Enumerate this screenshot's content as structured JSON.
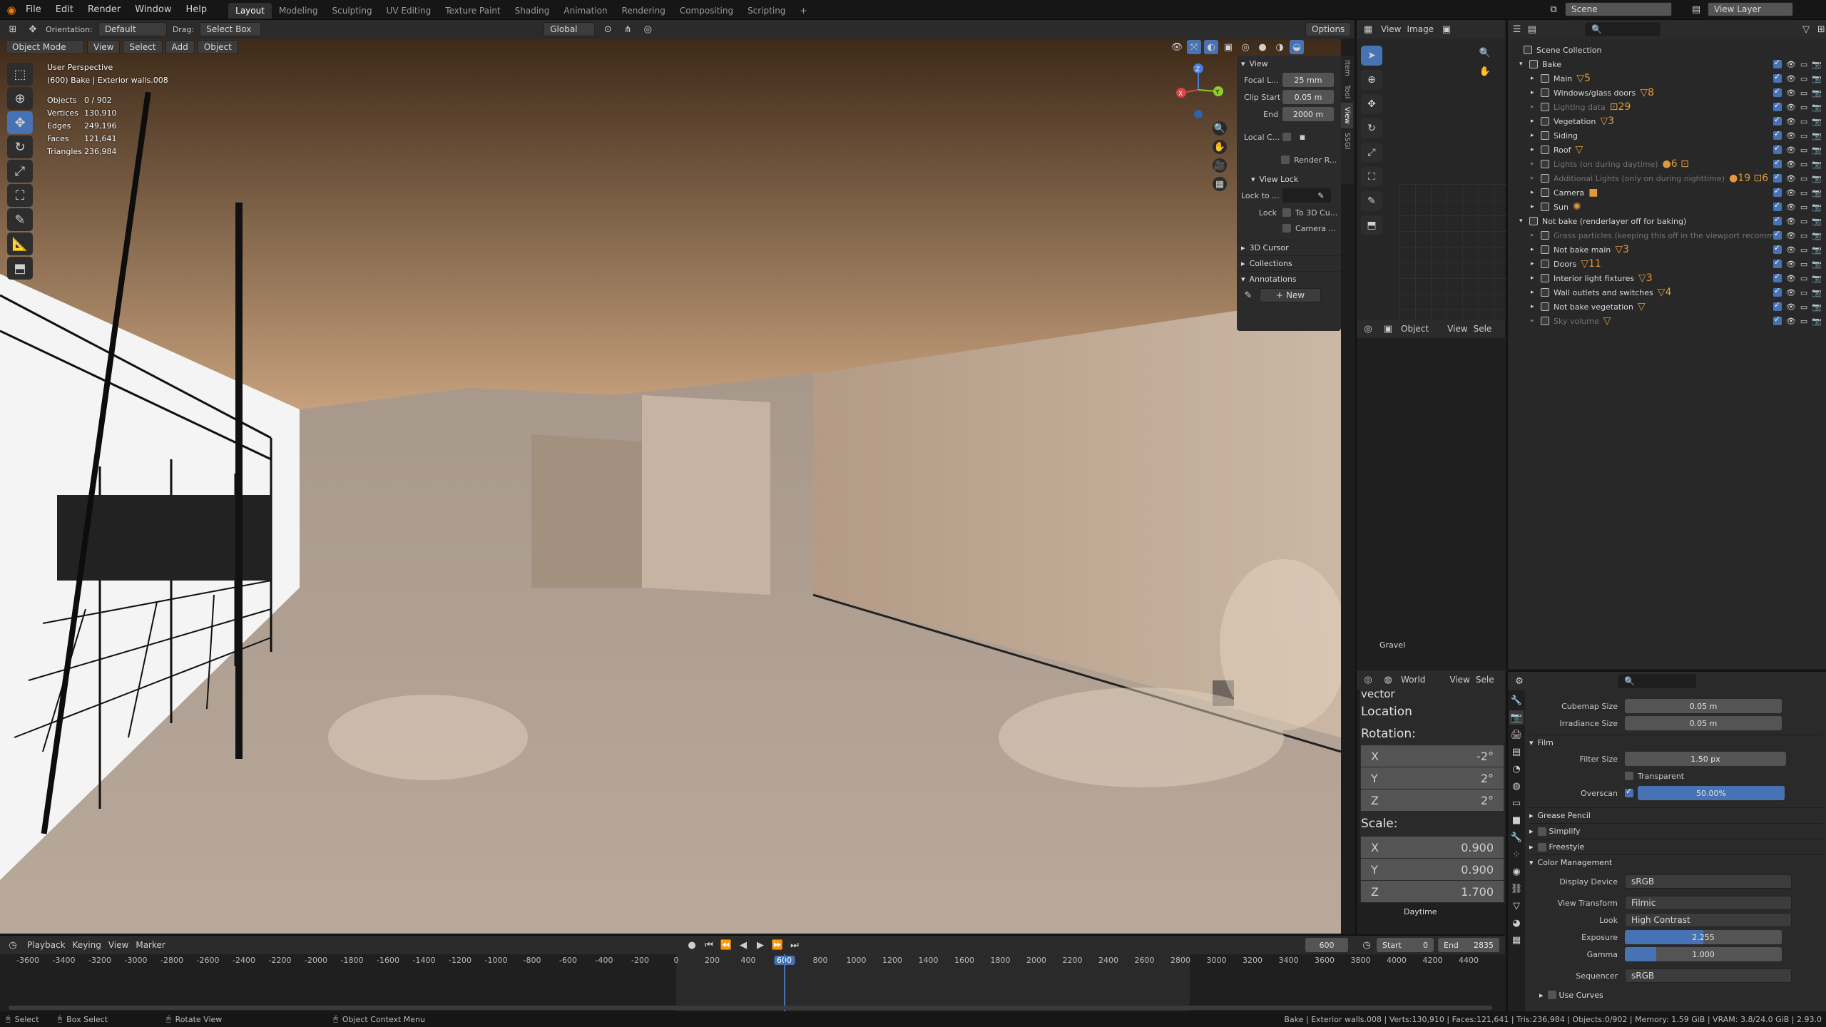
{
  "topbar": {
    "menus": [
      "File",
      "Edit",
      "Render",
      "Window",
      "Help"
    ],
    "workspaces": [
      "Layout",
      "Modeling",
      "Sculpting",
      "UV Editing",
      "Texture Paint",
      "Shading",
      "Animation",
      "Rendering",
      "Compositing",
      "Scripting"
    ],
    "active_workspace": "Layout",
    "add_tab": "+",
    "scene": "Scene",
    "view_layer": "View Layer"
  },
  "toolheader": {
    "orientation_label": "Orientation:",
    "orientation_value": "Default",
    "drag_label": "Drag:",
    "drag_value": "Select Box",
    "transform_orientation": "Global",
    "options": "Options"
  },
  "viewport_header": {
    "mode": "Object Mode",
    "menus": [
      "View",
      "Select",
      "Add",
      "Object"
    ]
  },
  "overlay_text": {
    "perspective": "User Perspective",
    "active": "(600) Bake | Exterior walls.008",
    "stats": [
      {
        "label": "Objects",
        "value": "0 / 902"
      },
      {
        "label": "Vertices",
        "value": "130,910"
      },
      {
        "label": "Edges",
        "value": "249,196"
      },
      {
        "label": "Faces",
        "value": "121,641"
      },
      {
        "label": "Triangles",
        "value": "236,984"
      }
    ]
  },
  "gizmo": {
    "x": "X",
    "y": "Y",
    "z": "Z"
  },
  "npanel": {
    "tabs": [
      "Item",
      "Tool",
      "View",
      "SSGI"
    ],
    "view_header": "View",
    "focal_label": "Focal L...",
    "focal_value": "25 mm",
    "clip_start_label": "Clip Start",
    "clip_start_value": "0.05 m",
    "end_label": "End",
    "end_value": "2000 m",
    "local_camera_label": "Local C...",
    "render_region": "Render R...",
    "view_lock_header": "View Lock",
    "lock_to_label": "Lock to ...",
    "lock_label": "Lock",
    "lock_3d_cursor": "To 3D Cu...",
    "lock_camera": "Camera ...",
    "cursor_header": "3D Cursor",
    "collections_header": "Collections",
    "annotations_header": "Annotations",
    "new_button": "New"
  },
  "image_editor": {
    "menus": [
      "View",
      "Image"
    ],
    "node_header_menus": [
      "Object",
      "View",
      "Sele"
    ],
    "gravel_label": "Gravel"
  },
  "world_node": {
    "header": "World",
    "menus": [
      "View",
      "Sele"
    ],
    "vector_label": "Vector",
    "location": "Location",
    "rotation": "Rotation:",
    "rotation_values": [
      {
        "axis": "X",
        "value": "-2°"
      },
      {
        "axis": "Y",
        "value": "2°"
      },
      {
        "axis": "Z",
        "value": "2°"
      }
    ],
    "scale": "Scale:",
    "scale_values": [
      {
        "axis": "X",
        "value": "0.900"
      },
      {
        "axis": "Y",
        "value": "0.900"
      },
      {
        "axis": "Z",
        "value": "1.700"
      }
    ],
    "footer": "Daytime"
  },
  "outliner": {
    "root": "Scene Collection",
    "items": [
      {
        "label": "Bake",
        "level": 0,
        "dim": false,
        "icons": ""
      },
      {
        "label": "Main",
        "level": 1,
        "dim": false,
        "icons": "▽5"
      },
      {
        "label": "Windows/glass doors",
        "level": 1,
        "dim": false,
        "icons": "▽8"
      },
      {
        "label": "Lighting data",
        "level": 1,
        "dim": true,
        "icons": "⊡29"
      },
      {
        "label": "Vegetation",
        "level": 1,
        "dim": false,
        "icons": "▽3"
      },
      {
        "label": "Siding",
        "level": 1,
        "dim": false,
        "icons": ""
      },
      {
        "label": "Roof",
        "level": 1,
        "dim": false,
        "icons": "▽"
      },
      {
        "label": "Lights (on during daytime)",
        "level": 1,
        "dim": true,
        "icons": "●6 ⊡"
      },
      {
        "label": "Additional Lights (only on during nighttime)",
        "level": 1,
        "dim": true,
        "icons": "●19 ⊡6"
      },
      {
        "label": "Camera",
        "level": 1,
        "dim": false,
        "icons": "■"
      },
      {
        "label": "Sun",
        "level": 1,
        "dim": false,
        "icons": "✺"
      },
      {
        "label": "Not bake (renderlayer off for baking)",
        "level": 0,
        "dim": false,
        "icons": ""
      },
      {
        "label": "Grass particles (keeping this off in the viewport recomm",
        "level": 1,
        "dim": true,
        "icons": ""
      },
      {
        "label": "Not bake main",
        "level": 1,
        "dim": false,
        "icons": "▽3"
      },
      {
        "label": "Doors",
        "level": 1,
        "dim": false,
        "icons": "▽11"
      },
      {
        "label": "Interior light fixtures",
        "level": 1,
        "dim": false,
        "icons": "▽3"
      },
      {
        "label": "Wall outlets and switches",
        "level": 1,
        "dim": false,
        "icons": "▽4"
      },
      {
        "label": "Not bake vegetation",
        "level": 1,
        "dim": false,
        "icons": "▽"
      },
      {
        "label": "Sky volume",
        "level": 1,
        "dim": true,
        "icons": "▽"
      }
    ]
  },
  "properties": {
    "cubemap_label": "Cubemap Size",
    "cubemap_value": "0.05 m",
    "irradiance_label": "Irradiance Size",
    "irradiance_value": "0.05 m",
    "film_header": "Film",
    "filter_label": "Filter Size",
    "filter_value": "1.50 px",
    "transparent_label": "Transparent",
    "overscan_label": "Overscan",
    "overscan_value": "50.00%",
    "overscan_fraction": 0.5,
    "grease_pencil": "Grease Pencil",
    "simplify": "Simplify",
    "freestyle": "Freestyle",
    "color_mgmt": "Color Management",
    "display_label": "Display Device",
    "display_value": "sRGB",
    "view_transform_label": "View Transform",
    "view_transform_value": "Filmic",
    "look_label": "Look",
    "look_value": "High Contrast",
    "exposure_label": "Exposure",
    "exposure_value": "2.255",
    "gamma_label": "Gamma",
    "gamma_value": "1.000",
    "sequencer_label": "Sequencer",
    "sequencer_value": "sRGB",
    "use_curves": "Use Curves"
  },
  "timeline": {
    "menus": [
      "Playback",
      "Keying",
      "View",
      "Marker"
    ],
    "current_frame": "600",
    "start_label": "Start",
    "start_value": "0",
    "end_label": "End",
    "end_value": "2835",
    "ticks": [
      "-3600",
      "-3400",
      "-3200",
      "-3000",
      "-2800",
      "-2600",
      "-2400",
      "-2200",
      "-2000",
      "-1800",
      "-1600",
      "-1400",
      "-1200",
      "-1000",
      "-800",
      "-600",
      "-400",
      "-200",
      "0",
      "200",
      "400",
      "600",
      "800",
      "1000",
      "1200",
      "1400",
      "1600",
      "1800",
      "2000",
      "2200",
      "2400",
      "2600",
      "2800",
      "3000",
      "3200",
      "3400",
      "3600",
      "3800",
      "4000",
      "4200",
      "4400"
    ]
  },
  "statusbar": {
    "select": "Select",
    "box_select": "Box Select",
    "rotate_view": "Rotate View",
    "context_menu": "Object Context Menu",
    "info": "Bake | Exterior walls.008 | Verts:130,910 | Faces:121,641 | Tris:236,984 | Objects:0/902 | Memory: 1.59 GiB | VRAM: 3.8/24.0 GiB | 2.93.0"
  }
}
